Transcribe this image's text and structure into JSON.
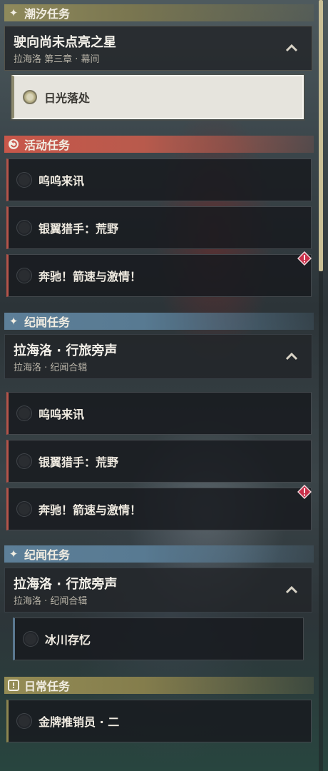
{
  "categories": {
    "tide": "潮汐任务",
    "event": "活动任务",
    "lore1": "纪闻任务",
    "lore2": "纪闻任务",
    "daily": "日常任务"
  },
  "tide_group": {
    "title": "驶向尚未点亮之星",
    "subtitle": "拉海洛 第三章 · 幕间",
    "quest": "日光落处"
  },
  "event_quests": [
    "呜呜来讯",
    "银翼猎手：荒野",
    "奔驰！箭速与激情！"
  ],
  "lore_group_1": {
    "title": "拉海洛 · 行旅旁声",
    "subtitle": "拉海洛 · 纪闻合辑",
    "quests": [
      "呜呜来讯",
      "银翼猎手：荒野",
      "奔驰！箭速与激情！"
    ]
  },
  "lore_group_2": {
    "title": "拉海洛 · 行旅旁声",
    "subtitle": "拉海洛 · 纪闻合辑",
    "quest": "冰川存忆"
  },
  "daily_quest": "金牌推销员 · 二",
  "icons": {
    "tide": "sparkle-icon",
    "event": "event-swirl-icon",
    "lore": "sparkle-icon",
    "daily": "exclamation-box-icon",
    "collapse": "chevron-up-icon",
    "alert": "warning-diamond-icon"
  },
  "colors": {
    "tide": "#8f8a5c",
    "event": "#c8574a",
    "lore": "#5d7f98",
    "daily": "#948c55",
    "alert": "#c8304a"
  }
}
